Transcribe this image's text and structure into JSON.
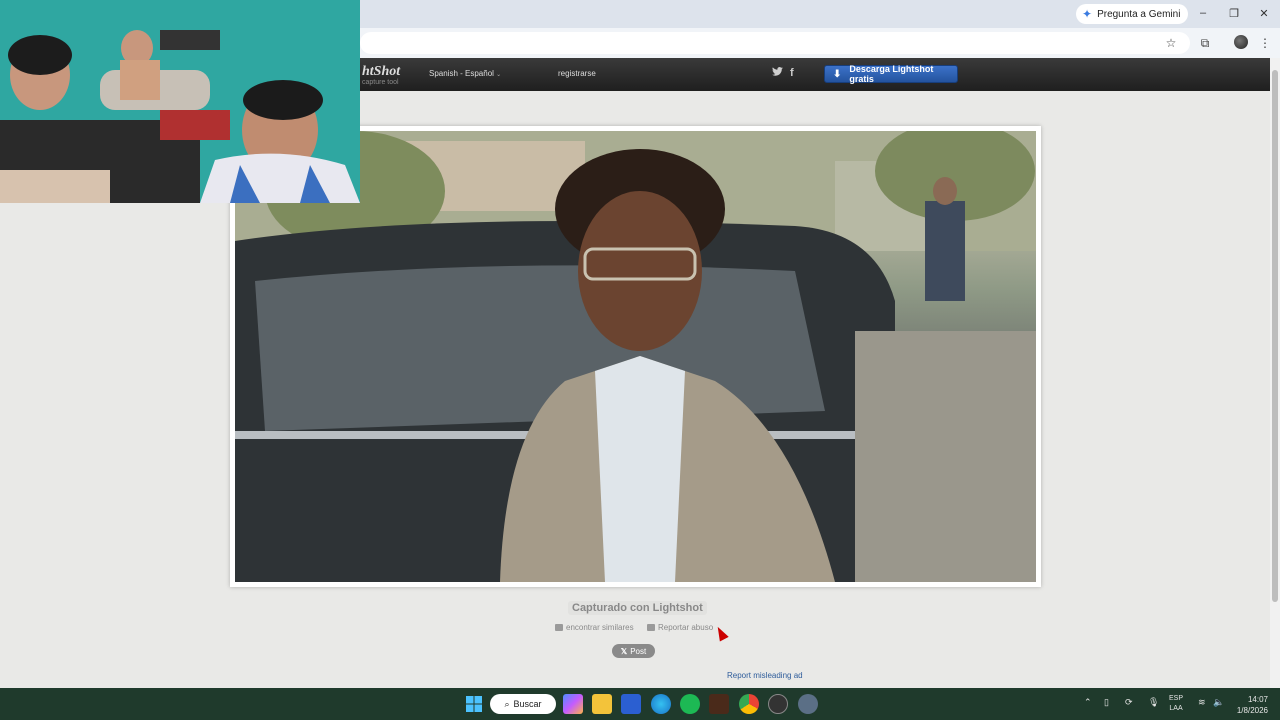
{
  "browser": {
    "gemini_label": "Pregunta a Gemini",
    "window_controls": {
      "minimize": "–",
      "restore": "❐",
      "close": "✕"
    },
    "toolbar_icons": [
      "star-icon",
      "extensions-icon",
      "profile-avatar",
      "menu-icon"
    ]
  },
  "lightshot": {
    "logo_text": "htShot",
    "tagline": "capture tool",
    "language": "Spanish - Español",
    "register": "registrarse",
    "download_button": "Descarga Lightshot gratis",
    "captured_with": "Capturado con Lightshot",
    "find_similar": "encontrar similares",
    "report_abuse": "Reportar abuso",
    "post_button": "Post",
    "report_ad": "Report misleading ad"
  },
  "taskbar": {
    "search_label": "Buscar",
    "apps": [
      "windows-start",
      "copilot",
      "file-explorer",
      "store",
      "edge",
      "spotify",
      "game",
      "chrome",
      "obs",
      "settings"
    ],
    "lang_line1": "ESP",
    "lang_line2": "LAA",
    "time": "14:07",
    "date": "1/8/2026"
  },
  "colors": {
    "download_blue": "#2a5db0",
    "taskbar_bg": "#1f3a2c",
    "webcam_wall": "#2fa7a1"
  }
}
